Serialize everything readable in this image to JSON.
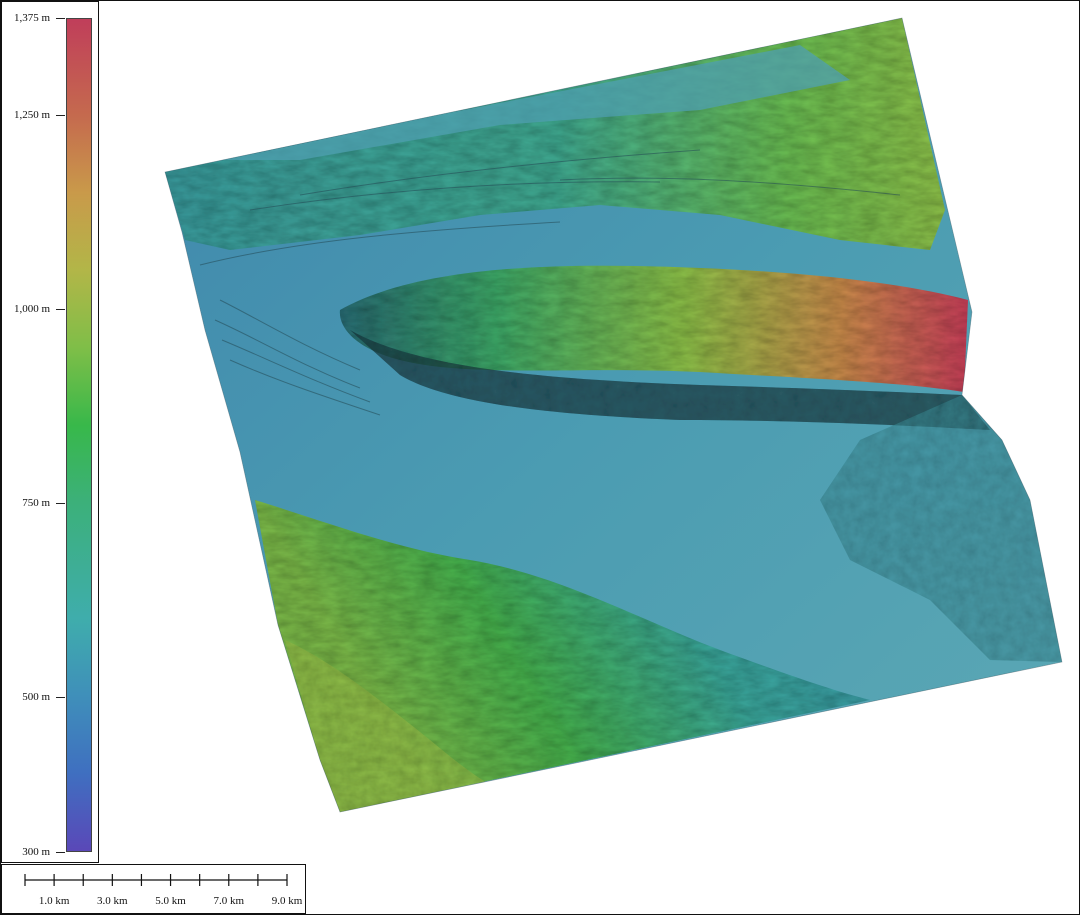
{
  "legend": {
    "ticks": [
      {
        "label": "1,375 m",
        "value": 1375
      },
      {
        "label": "1,250 m",
        "value": 1250
      },
      {
        "label": "1,000 m",
        "value": 1000
      },
      {
        "label": "750 m",
        "value": 750
      },
      {
        "label": "500 m",
        "value": 500
      },
      {
        "label": "300 m",
        "value": 300
      }
    ],
    "min": 300,
    "max": 1375,
    "gradient": [
      {
        "value": 300,
        "color": "#5a48b8"
      },
      {
        "value": 400,
        "color": "#3f6fc0"
      },
      {
        "value": 500,
        "color": "#3f8fba"
      },
      {
        "value": 600,
        "color": "#3fadac"
      },
      {
        "value": 750,
        "color": "#3cb07a"
      },
      {
        "value": 850,
        "color": "#38b84a"
      },
      {
        "value": 950,
        "color": "#7fbe48"
      },
      {
        "value": 1050,
        "color": "#b2b648"
      },
      {
        "value": 1150,
        "color": "#c99a4a"
      },
      {
        "value": 1250,
        "color": "#c56a4e"
      },
      {
        "value": 1375,
        "color": "#c03e5a"
      }
    ]
  },
  "scalebar": {
    "labels": [
      "1.0 km",
      "3.0 km",
      "5.0 km",
      "7.0 km",
      "9.0 km"
    ]
  },
  "colors": {
    "plain": "#4a9ab0",
    "high_ridge": "#c54c58",
    "mid_ridge": "#58b449",
    "border": "#111111"
  }
}
